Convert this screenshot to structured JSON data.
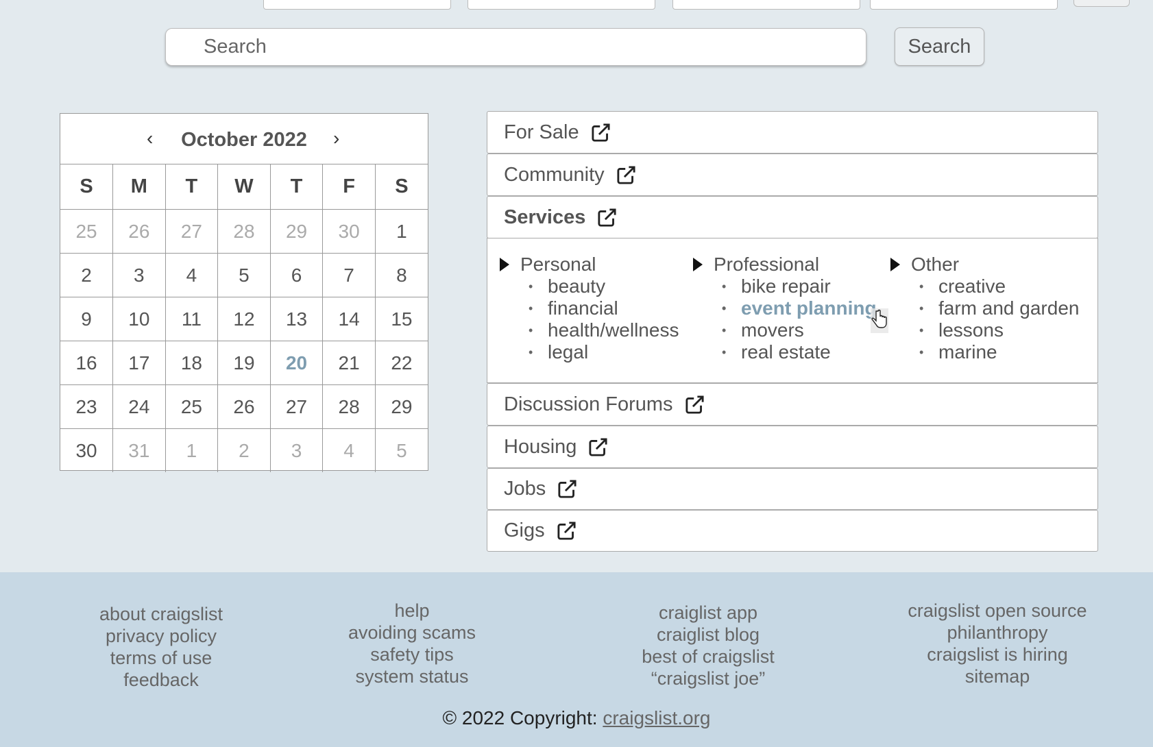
{
  "search": {
    "placeholder": "Search",
    "button_label": "Search"
  },
  "calendar": {
    "month_title": "October 2022",
    "prev_label": "‹",
    "next_label": "›",
    "weekdays": [
      "S",
      "M",
      "T",
      "W",
      "T",
      "F",
      "S"
    ],
    "weeks": [
      [
        {
          "d": "25",
          "m": true
        },
        {
          "d": "26",
          "m": true
        },
        {
          "d": "27",
          "m": true
        },
        {
          "d": "28",
          "m": true
        },
        {
          "d": "29",
          "m": true
        },
        {
          "d": "30",
          "m": true
        },
        {
          "d": "1"
        }
      ],
      [
        {
          "d": "2"
        },
        {
          "d": "3"
        },
        {
          "d": "4"
        },
        {
          "d": "5"
        },
        {
          "d": "6"
        },
        {
          "d": "7"
        },
        {
          "d": "8"
        }
      ],
      [
        {
          "d": "9"
        },
        {
          "d": "10"
        },
        {
          "d": "11"
        },
        {
          "d": "12"
        },
        {
          "d": "13"
        },
        {
          "d": "14"
        },
        {
          "d": "15"
        }
      ],
      [
        {
          "d": "16"
        },
        {
          "d": "17"
        },
        {
          "d": "18"
        },
        {
          "d": "19"
        },
        {
          "d": "20",
          "today": true
        },
        {
          "d": "21"
        },
        {
          "d": "22"
        }
      ],
      [
        {
          "d": "23"
        },
        {
          "d": "24"
        },
        {
          "d": "25"
        },
        {
          "d": "26"
        },
        {
          "d": "27"
        },
        {
          "d": "28"
        },
        {
          "d": "29"
        }
      ],
      [
        {
          "d": "30"
        },
        {
          "d": "31",
          "m": true
        },
        {
          "d": "1",
          "m": true
        },
        {
          "d": "2",
          "m": true
        },
        {
          "d": "3",
          "m": true
        },
        {
          "d": "4",
          "m": true
        },
        {
          "d": "5",
          "m": true
        }
      ]
    ]
  },
  "categories": {
    "for_sale": "For Sale",
    "community": "Community",
    "services": "Services",
    "discussion_forums": "Discussion Forums",
    "housing": "Housing",
    "jobs": "Jobs",
    "gigs": "Gigs"
  },
  "services_panel": {
    "personal": {
      "title": "Personal",
      "items": [
        "beauty",
        "financial",
        "health/wellness",
        "legal"
      ]
    },
    "professional": {
      "title": "Professional",
      "items": [
        "bike repair",
        "event planning",
        "movers",
        "real estate"
      ],
      "active": "event planning"
    },
    "other": {
      "title": "Other",
      "items": [
        "creative",
        "farm and garden",
        "lessons",
        "marine"
      ]
    }
  },
  "footer": {
    "col1": [
      "about craigslist",
      "privacy policy",
      "terms of use",
      "feedback"
    ],
    "col2": [
      "help",
      "avoiding scams",
      "safety tips",
      "system status"
    ],
    "col3": [
      "craiglist app",
      "craiglist blog",
      "best of craigslist",
      "“craigslist joe”"
    ],
    "col4": [
      "craigslist open source",
      "philanthropy",
      "craigslist is hiring",
      "sitemap"
    ],
    "copyright_prefix": "© 2022 Copyright: ",
    "copyright_link": "craigslist.org"
  },
  "colors": {
    "background": "#e3eaee",
    "footer": "#c7d8e4",
    "accent": "#7e9db0"
  },
  "icons": {
    "category_link": "external-link-icon",
    "subcategory_toggle": "caret-right-icon",
    "pointer": "hand-cursor-icon"
  }
}
